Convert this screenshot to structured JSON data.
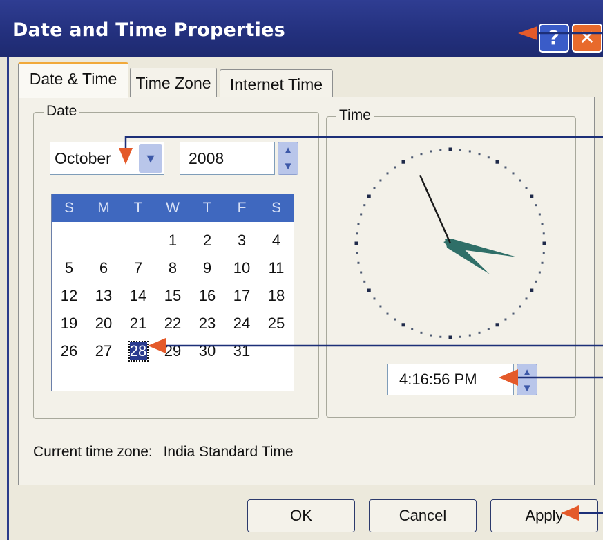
{
  "window": {
    "title": "Date and Time Properties",
    "help_label": "?",
    "close_label": "✕"
  },
  "tabs": [
    {
      "label": "Date & Time",
      "active": true
    },
    {
      "label": "Time Zone",
      "active": false
    },
    {
      "label": "Internet Time",
      "active": false
    }
  ],
  "date_group": {
    "label": "Date",
    "month": "October",
    "year": "2008",
    "weekdays": [
      "S",
      "M",
      "T",
      "W",
      "T",
      "F",
      "S"
    ],
    "weeks": [
      [
        "",
        "",
        "",
        "1",
        "2",
        "3",
        "4"
      ],
      [
        "5",
        "6",
        "7",
        "8",
        "9",
        "10",
        "11"
      ],
      [
        "12",
        "13",
        "14",
        "15",
        "16",
        "17",
        "18"
      ],
      [
        "19",
        "20",
        "21",
        "22",
        "23",
        "24",
        "25"
      ],
      [
        "26",
        "27",
        "28",
        "29",
        "30",
        "31",
        ""
      ]
    ],
    "selected_day": "28"
  },
  "time_group": {
    "label": "Time",
    "time_value": "4:16:56 PM",
    "clock": {
      "hours": 4,
      "minutes": 16,
      "seconds": 56
    }
  },
  "timezone": {
    "label": "Current time zone:",
    "value": "India Standard Time"
  },
  "buttons": {
    "ok": "OK",
    "cancel": "Cancel",
    "apply": "Apply"
  },
  "colors": {
    "titlebar": "#23307d",
    "calendar_header": "#3f68bf",
    "clock_hands": "#2f6f68",
    "annotation_arrow": "#e45a2a",
    "annotation_line": "#1c2f78"
  },
  "icons": [
    "help-icon",
    "close-icon",
    "dropdown-arrow-icon",
    "spin-up-icon",
    "spin-down-icon"
  ]
}
